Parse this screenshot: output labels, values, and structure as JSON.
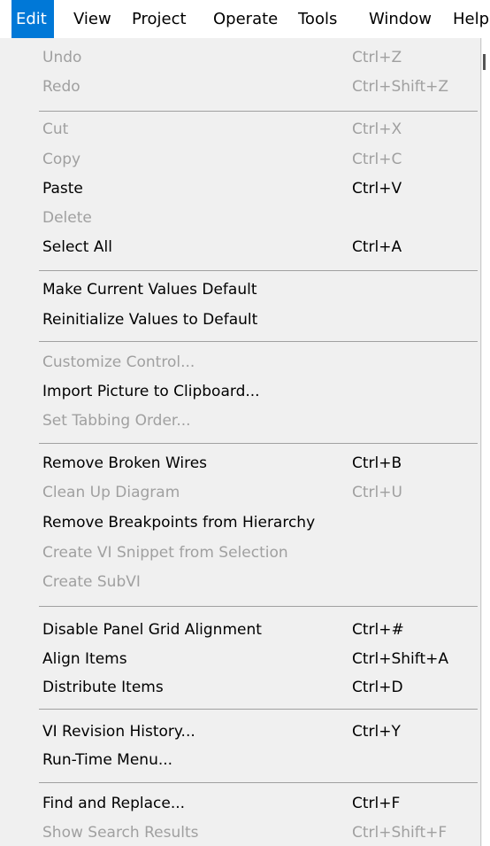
{
  "menubar": {
    "items": [
      {
        "label": "Edit"
      },
      {
        "label": "View"
      },
      {
        "label": "Project"
      },
      {
        "label": "Operate"
      },
      {
        "label": "Tools"
      },
      {
        "label": "Window"
      },
      {
        "label": "Help"
      }
    ]
  },
  "edit_menu": {
    "items": [
      {
        "label": "Undo",
        "shortcut": "Ctrl+Z",
        "enabled": false
      },
      {
        "label": "Redo",
        "shortcut": "Ctrl+Shift+Z",
        "enabled": false
      },
      {
        "label": "Cut",
        "shortcut": "Ctrl+X",
        "enabled": false
      },
      {
        "label": "Copy",
        "shortcut": "Ctrl+C",
        "enabled": false
      },
      {
        "label": "Paste",
        "shortcut": "Ctrl+V",
        "enabled": true
      },
      {
        "label": "Delete",
        "shortcut": "",
        "enabled": false
      },
      {
        "label": "Select All",
        "shortcut": "Ctrl+A",
        "enabled": true
      },
      {
        "label": "Make Current Values Default",
        "shortcut": "",
        "enabled": true
      },
      {
        "label": "Reinitialize Values to Default",
        "shortcut": "",
        "enabled": true
      },
      {
        "label": "Customize Control...",
        "shortcut": "",
        "enabled": false
      },
      {
        "label": "Import Picture to Clipboard...",
        "shortcut": "",
        "enabled": true
      },
      {
        "label": "Set Tabbing Order...",
        "shortcut": "",
        "enabled": false
      },
      {
        "label": "Remove Broken Wires",
        "shortcut": "Ctrl+B",
        "enabled": true
      },
      {
        "label": "Clean Up Diagram",
        "shortcut": "Ctrl+U",
        "enabled": false
      },
      {
        "label": "Remove Breakpoints from Hierarchy",
        "shortcut": "",
        "enabled": true
      },
      {
        "label": "Create VI Snippet from Selection",
        "shortcut": "",
        "enabled": false
      },
      {
        "label": "Create SubVI",
        "shortcut": "",
        "enabled": false
      },
      {
        "label": "Disable Panel Grid Alignment",
        "shortcut": "Ctrl+#",
        "enabled": true
      },
      {
        "label": "Align Items",
        "shortcut": "Ctrl+Shift+A",
        "enabled": true
      },
      {
        "label": "Distribute Items",
        "shortcut": "Ctrl+D",
        "enabled": true
      },
      {
        "label": "VI Revision History...",
        "shortcut": "Ctrl+Y",
        "enabled": true
      },
      {
        "label": "Run-Time Menu...",
        "shortcut": "",
        "enabled": true
      },
      {
        "label": "Find and Replace...",
        "shortcut": "Ctrl+F",
        "enabled": true
      },
      {
        "label": "Show Search Results",
        "shortcut": "Ctrl+Shift+F",
        "enabled": false
      }
    ]
  },
  "colors": {
    "menu_bg": "#f0f0f0",
    "active_menu_bg": "#0078d7",
    "disabled_text": "#a0a0a0",
    "separator": "#a0a0a0"
  }
}
